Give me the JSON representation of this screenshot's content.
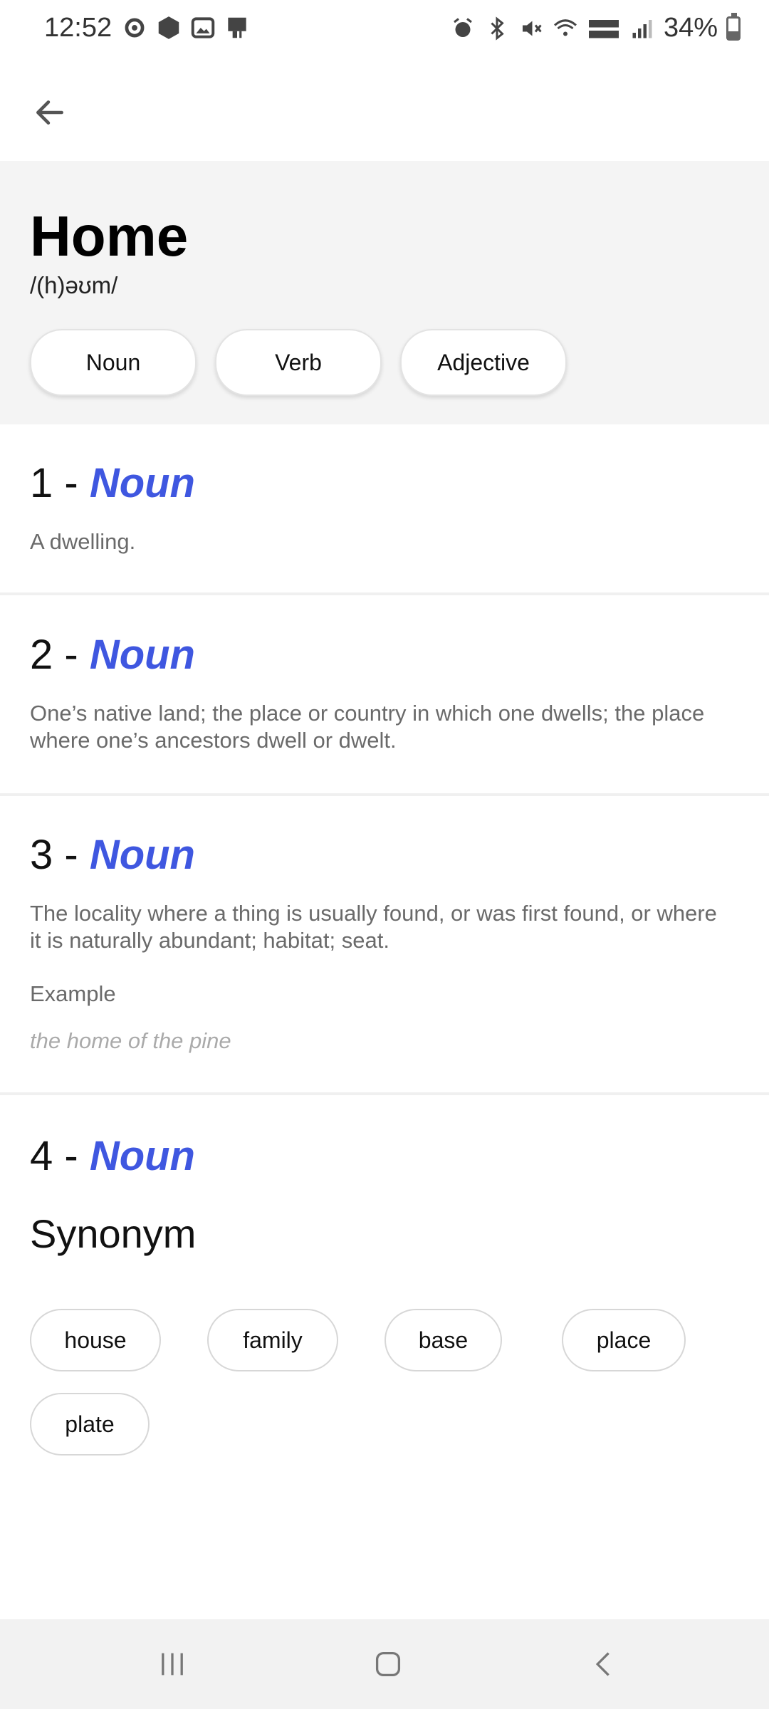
{
  "status": {
    "time": "12:52",
    "battery": "34%"
  },
  "header": {
    "word": "Home",
    "pronunciation": "/(h)əʊm/",
    "parts_of_speech": [
      "Noun",
      "Verb",
      "Adjective"
    ]
  },
  "definitions": [
    {
      "number": "1 - ",
      "pos": "Noun",
      "text": "A dwelling."
    },
    {
      "number": "2 - ",
      "pos": "Noun",
      "text": "One’s native land; the place or country in which one dwells; the place where one’s ancestors dwell or dwelt."
    },
    {
      "number": "3 - ",
      "pos": "Noun",
      "text": "The locality where a thing is usually found, or was first found, or where it is naturally abundant; habitat; seat.",
      "example_label": "Example",
      "example": "the home of the pine"
    },
    {
      "number": "4 - ",
      "pos": "Noun"
    }
  ],
  "synonyms": {
    "title": "Synonym",
    "items": [
      "house",
      "family",
      "base",
      "place",
      "plate"
    ]
  },
  "colors": {
    "accent": "#3f57e0",
    "header_bg": "#f4f4f4"
  }
}
